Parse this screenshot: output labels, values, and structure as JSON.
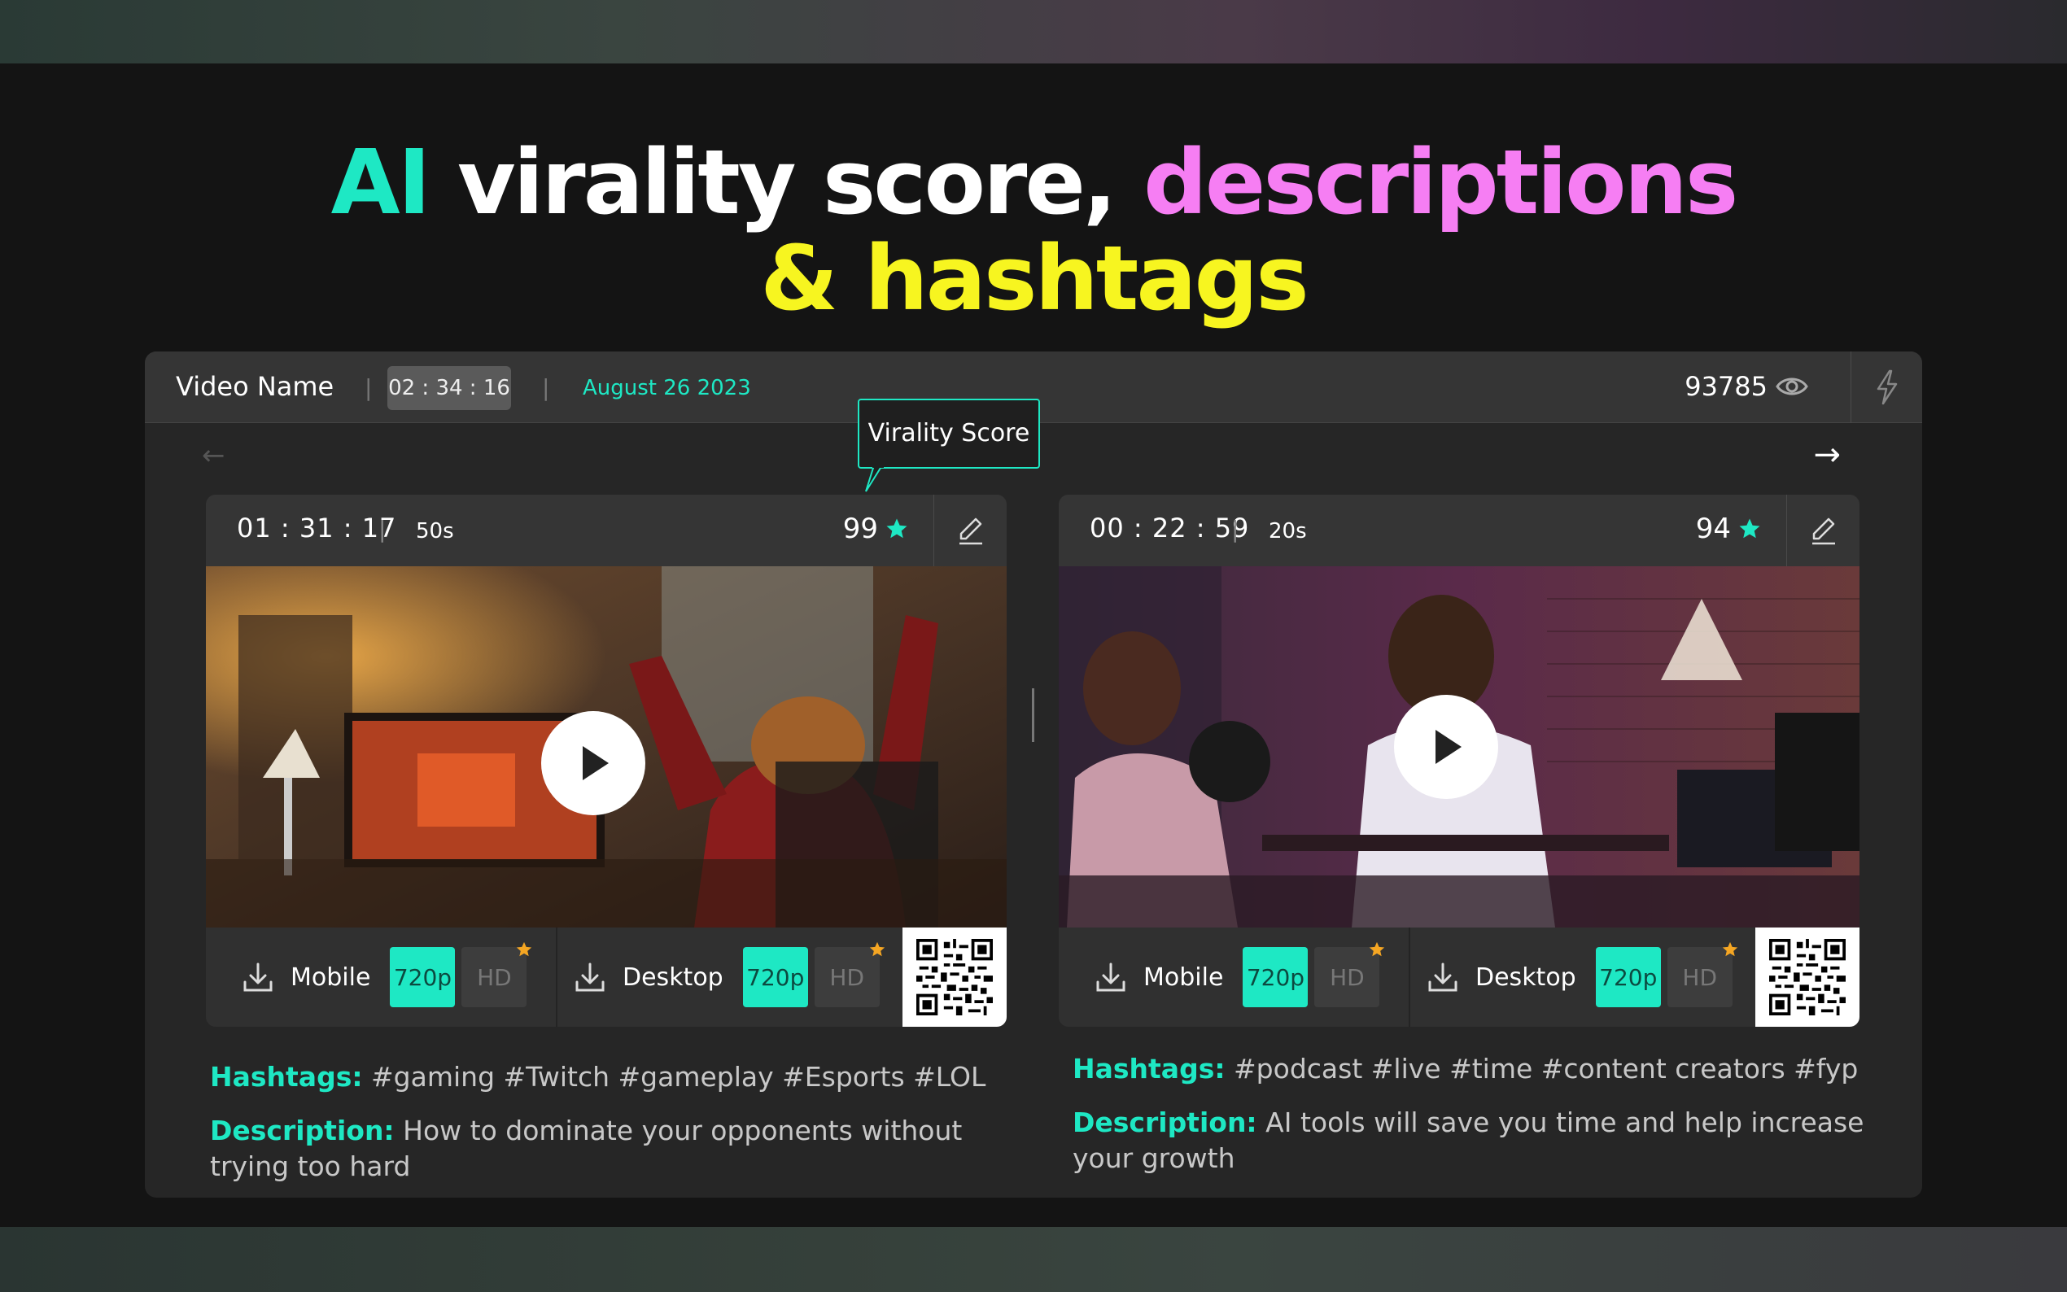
{
  "headline": {
    "part1": "AI",
    "part2": "virality score,",
    "part3": "descriptions",
    "part4": "& hashtags"
  },
  "header": {
    "video_name": "Video Name",
    "separator": "|",
    "time": "02 : 34 : 16",
    "date": "August  26 2023",
    "views": "93785",
    "views_icon": "eye-icon",
    "action_icon": "lightning-icon"
  },
  "nav": {
    "prev_arrow": "←",
    "next_arrow": "→"
  },
  "tooltip": {
    "label": "Virality Score"
  },
  "colors": {
    "accent": "#1ee8c4",
    "pink": "#f67ef3",
    "yellow": "#f7f520",
    "star_premium": "#f5a623"
  },
  "clips": [
    {
      "time": "01 : 31 : 17",
      "separator": "|",
      "duration": "50s",
      "score": "99",
      "mobile_label": "Mobile",
      "desktop_label": "Desktop",
      "q_720": "720p",
      "q_hd": "HD",
      "hashtags_key": "Hashtags:",
      "hashtags": "#gaming #Twitch #gameplay #Esports #LOL",
      "description_key": "Description:",
      "description": "How to dominate your opponents without trying too hard"
    },
    {
      "time": "00 : 22 : 59",
      "separator": "|",
      "duration": "20s",
      "score": "94",
      "mobile_label": "Mobile",
      "desktop_label": "Desktop",
      "q_720": "720p",
      "q_hd": "HD",
      "hashtags_key": "Hashtags:",
      "hashtags": "#podcast #live #time #content creators #fyp",
      "description_key": "Description:",
      "description": "AI tools will save you time and help increase your growth"
    }
  ]
}
